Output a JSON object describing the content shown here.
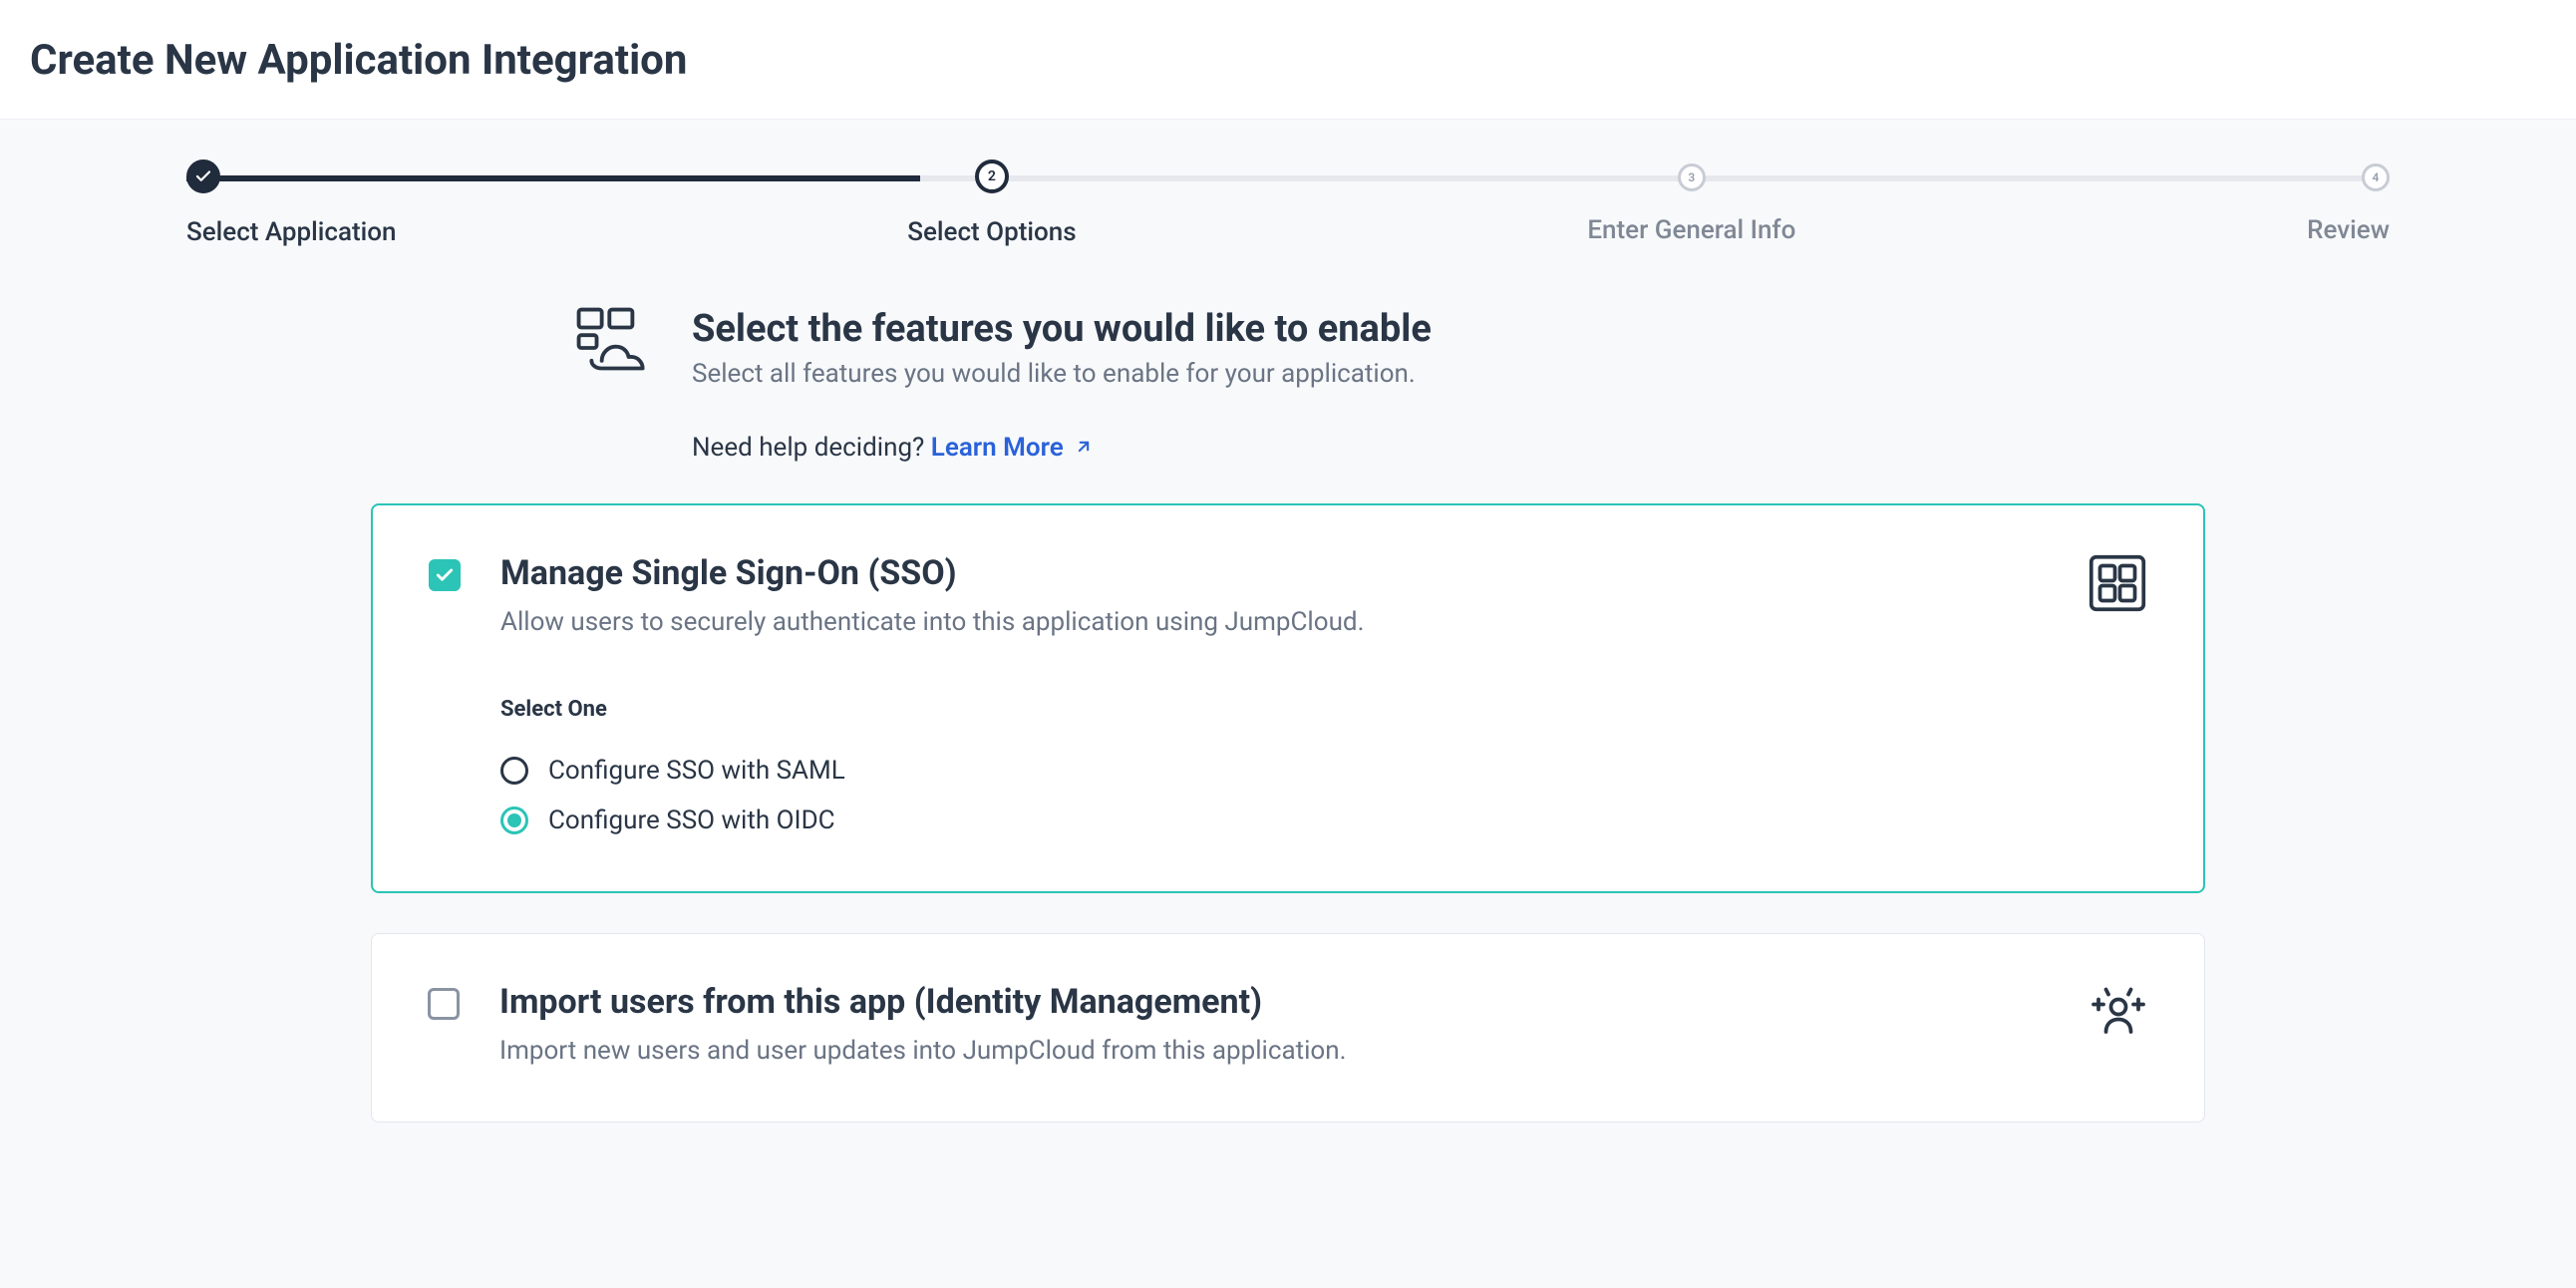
{
  "header": {
    "title": "Create New Application Integration"
  },
  "stepper": {
    "steps": [
      {
        "label": "Select Application",
        "num": "",
        "state": "done"
      },
      {
        "label": "Select Options",
        "num": "2",
        "state": "current"
      },
      {
        "label": "Enter General Info",
        "num": "3",
        "state": "future"
      },
      {
        "label": "Review",
        "num": "4",
        "state": "future"
      }
    ]
  },
  "section": {
    "title": "Select the features you would like to enable",
    "subtitle": "Select all features you would like to enable for your application.",
    "helper_prefix": "Need help deciding? ",
    "helper_link": "Learn More"
  },
  "cards": {
    "sso": {
      "title": "Manage Single Sign-On (SSO)",
      "desc": "Allow users to securely authenticate into this application using JumpCloud.",
      "select_one": "Select One",
      "options": [
        {
          "label": "Configure SSO with SAML",
          "selected": false
        },
        {
          "label": "Configure SSO with OIDC",
          "selected": true
        }
      ],
      "checked": true
    },
    "idm": {
      "title": "Import users from this app (Identity Management)",
      "desc": "Import new users and user updates into JumpCloud from this application.",
      "checked": false
    }
  }
}
